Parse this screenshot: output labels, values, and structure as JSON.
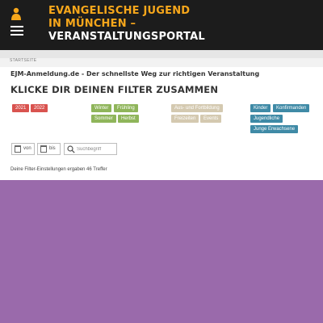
{
  "header": {
    "title_line1": "EVANGELISCHE JUGEND",
    "title_line2": "IN MÜNCHEN –",
    "title_line3": "VERANSTALTUNGSPORTAL",
    "brand_icon": "person-icon",
    "menu_icon": "hamburger-menu-icon",
    "accent_color": "#f7a71b"
  },
  "breadcrumb": {
    "label": "STARTSEITE"
  },
  "main": {
    "subtitle": "EJM-Anmeldung.de - Der schnellste Weg zur richtigen Veranstaltung",
    "headline": "KLICKE DIR DEINEN FILTER ZUSAMMEN"
  },
  "filters": {
    "years": [
      "2021",
      "2022"
    ],
    "seasons": [
      "Winter",
      "Frühling",
      "Sommer",
      "Herbst"
    ],
    "types": [
      "Aus- und Fortbildung",
      "Freizeiten",
      "Events"
    ],
    "audiences": [
      "Kinder",
      "Konfirmanden",
      "Jugendliche",
      "Junge Erwachsene"
    ],
    "colors": {
      "years": "#d9534f",
      "seasons": "#8fb55a",
      "types": "#d4c9b0",
      "audiences": "#3f8aa6"
    }
  },
  "search": {
    "from_label": "von",
    "to_label": "bis",
    "placeholder": "Suchbegriff"
  },
  "result_text": "Deine Filter-Einstellungen ergaben 46 Treffer",
  "background_color": "#9a6aab"
}
